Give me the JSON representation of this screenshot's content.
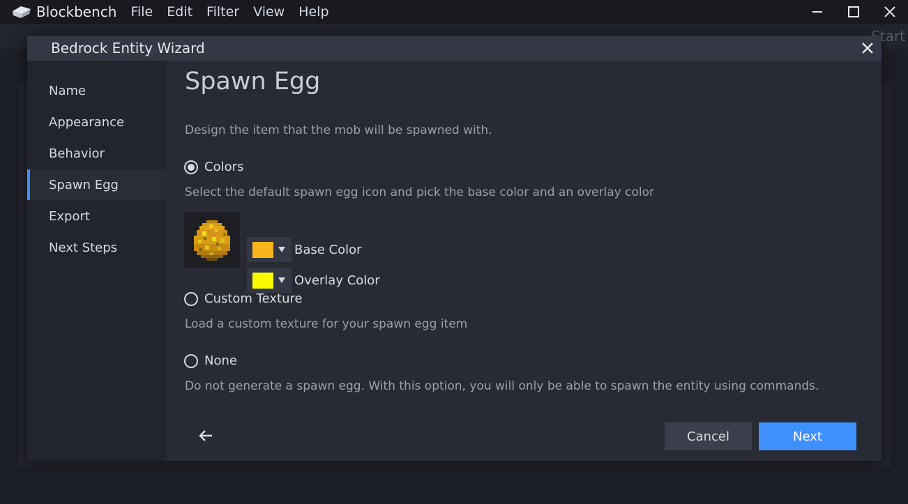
{
  "app": {
    "name": "Blockbench",
    "menu": [
      "File",
      "Edit",
      "Filter",
      "View",
      "Help"
    ],
    "background_tab": "Start"
  },
  "dialog": {
    "title": "Bedrock Entity Wizard",
    "sidebar": [
      {
        "label": "Name"
      },
      {
        "label": "Appearance"
      },
      {
        "label": "Behavior"
      },
      {
        "label": "Spawn Egg",
        "active": true
      },
      {
        "label": "Export"
      },
      {
        "label": "Next Steps"
      }
    ],
    "heading": "Spawn Egg",
    "description": "Design the item that the mob will be spawned with.",
    "options": {
      "colors": {
        "label": "Colors",
        "selected": true,
        "description": "Select the default spawn egg icon and pick the base color and an overlay color",
        "base_color": {
          "label": "Base Color",
          "value": "#fcb41e"
        },
        "overlay_color": {
          "label": "Overlay Color",
          "value": "#f9f900"
        }
      },
      "custom_texture": {
        "label": "Custom Texture",
        "selected": false,
        "description": "Load a custom texture for your spawn egg item"
      },
      "none": {
        "label": "None",
        "selected": false,
        "description": "Do not generate a spawn egg. With this option, you will only be able to spawn the entity using commands."
      }
    },
    "buttons": {
      "cancel": "Cancel",
      "next": "Next"
    },
    "icons": {
      "back": "arrow-left-icon",
      "close": "close-icon",
      "egg": "spawn-egg-icon"
    }
  },
  "colors": {
    "accent": "#3e90ff"
  }
}
